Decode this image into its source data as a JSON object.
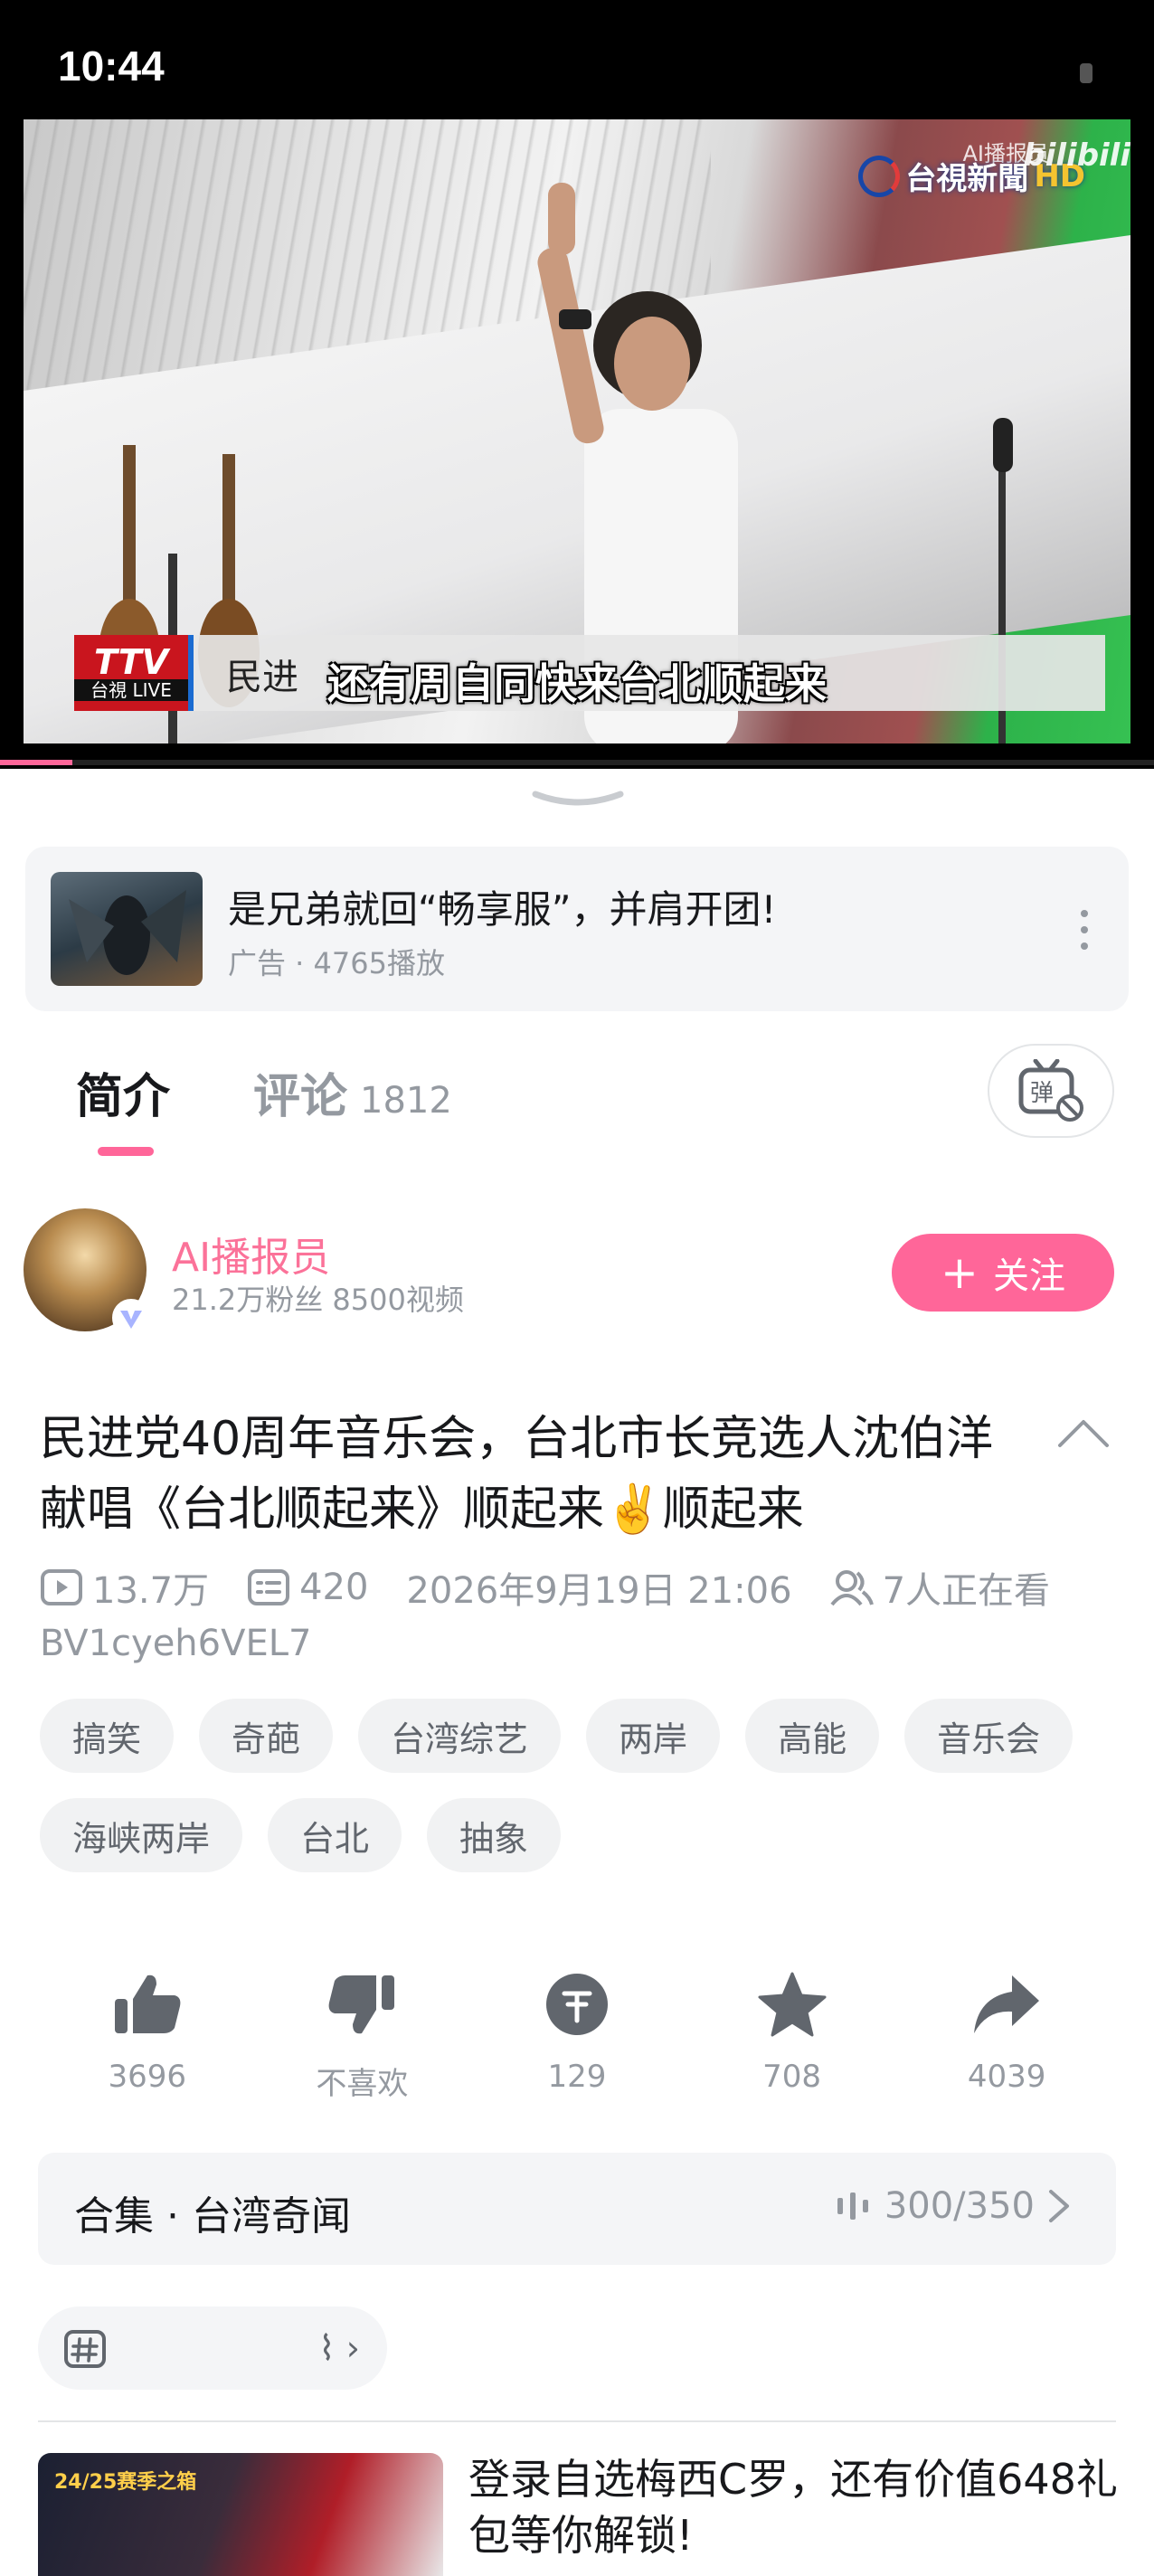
{
  "status_bar": {
    "time": "10:44"
  },
  "video": {
    "station": "台視新聞",
    "station_badge": "HD",
    "watermark": "AI播报员",
    "site_mark": "bilibili",
    "ttv_logo": "TTV",
    "ttv_sub": "台視 LIVE",
    "ticker_text": "民进",
    "subtitle": "还有周自同快来台北顺起来",
    "progress_fraction": 0.063
  },
  "ad": {
    "title": "是兄弟就回“畅享服”，并肩开团!",
    "meta": "广告 · 4765播放"
  },
  "tabs": {
    "intro": "简介",
    "comments": "评论",
    "comment_count": "1812"
  },
  "uploader": {
    "name": "AI播报员",
    "stats": "21.2万粉丝  8500视频",
    "follow_label": "关注"
  },
  "video_info": {
    "title": "民进党40周年音乐会，台北市长竞选人沈伯洋献唱《台北顺起来》顺起来✌️顺起来",
    "views": "13.7万",
    "danmaku": "420",
    "date": "2026年9月19日 21:06",
    "watching": "7人正在看",
    "bvid": "BV1cyeh6VEL7"
  },
  "tags": [
    "搞笑",
    "奇葩",
    "台湾综艺",
    "两岸",
    "高能",
    "音乐会",
    "海峡两岸",
    "台北",
    "抽象"
  ],
  "actions": [
    {
      "label": "3696",
      "icon": "thumbs-up-icon"
    },
    {
      "label": "不喜欢",
      "icon": "thumbs-down-icon"
    },
    {
      "label": "129",
      "icon": "coin-icon"
    },
    {
      "label": "708",
      "icon": "star-icon"
    },
    {
      "label": "4039",
      "icon": "share-icon"
    }
  ],
  "collection": {
    "title": "合集 · 台湾奇闻",
    "progress": "300/350"
  },
  "recommended": {
    "title": "登录自选梅西C罗，还有价值648礼包等你解锁!",
    "thumb_text": "24/25赛季之箱"
  },
  "colors": {
    "accent": "#ff6699",
    "uploader_name": "#fb7299",
    "muted_text": "#9499a0"
  }
}
